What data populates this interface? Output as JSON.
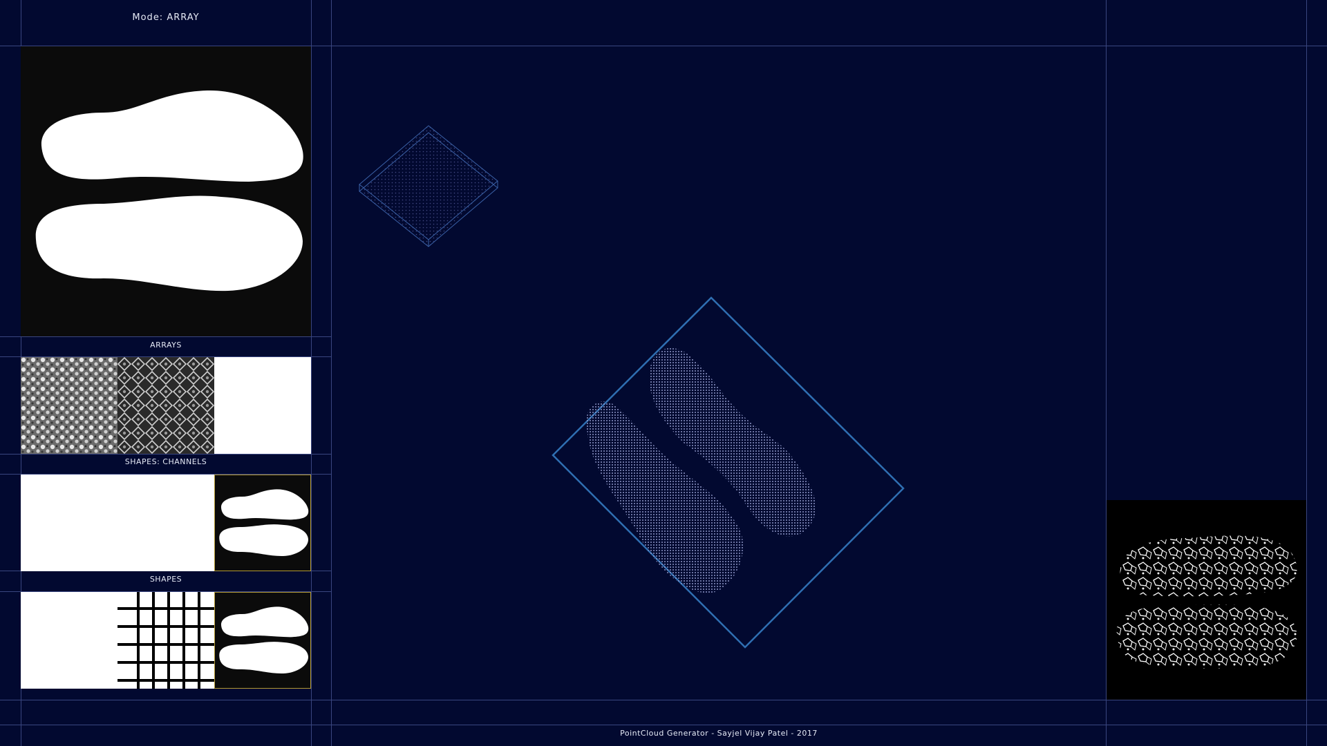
{
  "header": {
    "mode_label": "Mode: ARRAY"
  },
  "sections": {
    "arrays_label": "ARRAYS",
    "shapes_channels_label": "SHAPES: CHANNELS",
    "shapes_label": "SHAPES"
  },
  "footer": {
    "credit": "PointCloud Generator - Sayjel Vijay Patel - 2017"
  },
  "colors": {
    "background": "#020930",
    "grid_line": "#3a4680",
    "box_outline": "#2f6fb2",
    "point_color": "#8e96c8",
    "selected_outline": "#b49a33"
  },
  "icons": {
    "preview": "insole-silhouette-preview",
    "texture": "noise-texture-tile",
    "pattern": "diamond-pattern-tile",
    "grid": "grid-pattern-tile",
    "voronoi": "voronoi-preview"
  }
}
